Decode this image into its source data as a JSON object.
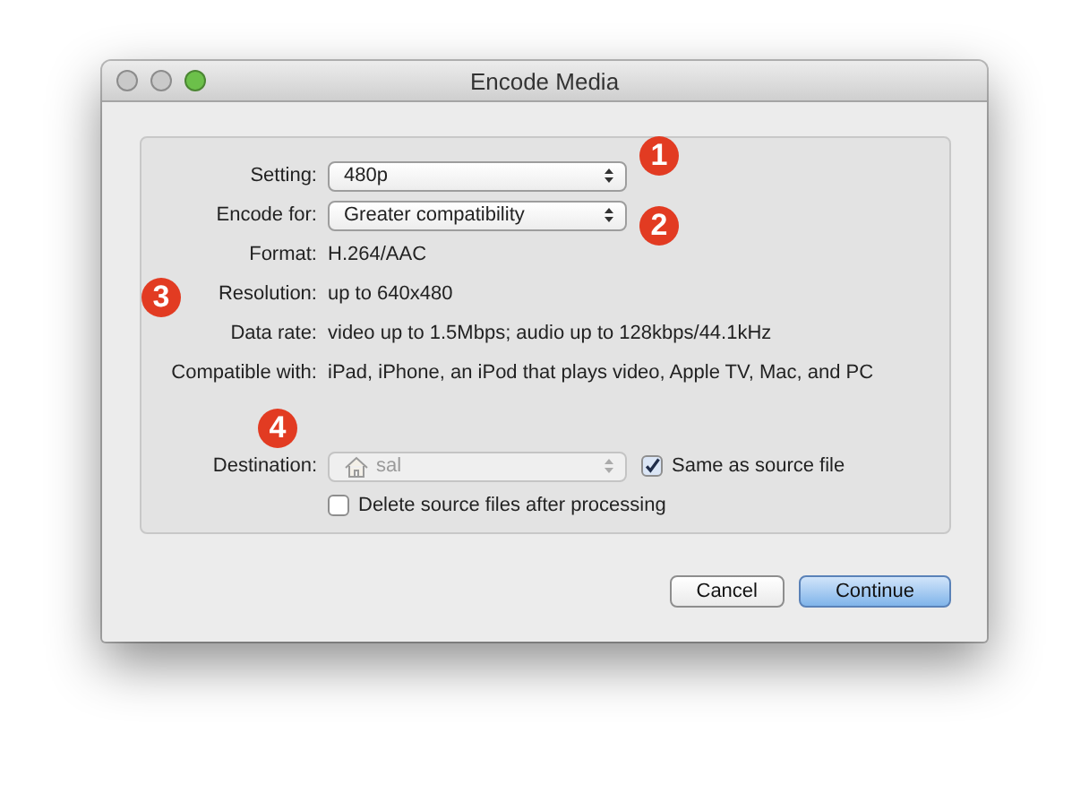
{
  "window": {
    "title": "Encode Media",
    "controls": [
      {
        "color": "#c9c9c9"
      },
      {
        "color": "#c9c9c9"
      },
      {
        "color": "#6cc04a"
      }
    ]
  },
  "form": {
    "rows": [
      {
        "kind": "popup",
        "label": "Setting:",
        "value": "480p",
        "disabled": false
      },
      {
        "kind": "popup",
        "label": "Encode for:",
        "value": "Greater compatibility",
        "disabled": false
      },
      {
        "kind": "info",
        "label": "Format:",
        "value": "H.264/AAC"
      },
      {
        "kind": "info",
        "label": "Resolution:",
        "value": "up to 640x480"
      },
      {
        "kind": "info",
        "label": "Data rate:",
        "value": "video up to 1.5Mbps; audio up to 128kbps/44.1kHz"
      },
      {
        "kind": "info",
        "label": "Compatible with:",
        "value": "iPad, iPhone, an iPod that plays video, Apple TV, Mac, and PC"
      },
      {
        "kind": "destination",
        "label": "Destination:",
        "value": "sal",
        "disabled": true,
        "option": {
          "label": "Same as source file",
          "checked": true
        }
      },
      {
        "kind": "checkbox",
        "label": "Delete source files after processing",
        "checked": false
      }
    ]
  },
  "buttons": [
    {
      "label": "Cancel",
      "default": false
    },
    {
      "label": "Continue",
      "default": true
    }
  ],
  "callouts": [
    "1",
    "2",
    "3",
    "4"
  ]
}
